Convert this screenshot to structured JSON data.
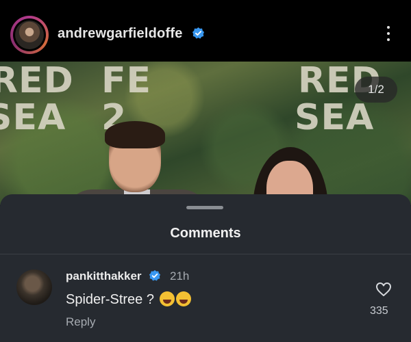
{
  "post": {
    "username": "andrewgarfieldoffe",
    "verified": true,
    "image_counter": "1/2",
    "backdrop_text": [
      "RED",
      "SEA",
      "RED",
      "SEA",
      "FE",
      "2"
    ]
  },
  "comments_sheet": {
    "title": "Comments",
    "comments": [
      {
        "username": "pankitthakker",
        "verified": true,
        "time": "21h",
        "text": "Spider-Stree ?",
        "emojis": "😂😂",
        "reply_label": "Reply",
        "likes": "335"
      }
    ]
  },
  "colors": {
    "verified_blue": "#3897f0",
    "sheet_background": "#262a30",
    "secondary_text": "#a6abb1"
  }
}
